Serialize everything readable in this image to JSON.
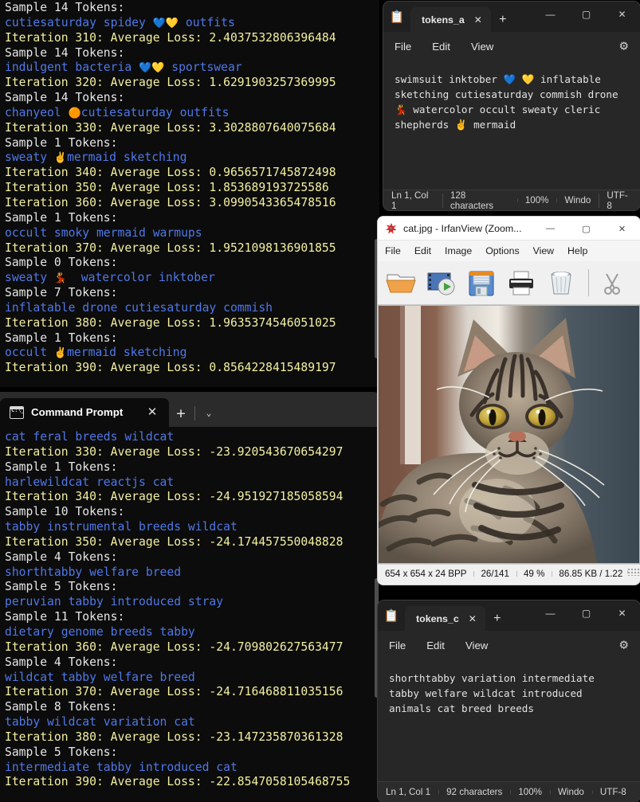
{
  "desktop": {
    "background": "#000000"
  },
  "terminal_top": {
    "background": "#0c0c0c",
    "colors": {
      "white": "#e6e6e6",
      "yellow": "#f3f0a0",
      "blue": "#4f78e8"
    },
    "lines": [
      {
        "kind": "white",
        "text": "Sample 14 Tokens:"
      },
      {
        "kind": "blue",
        "text": "cutiesaturday spidey 💙💛 outfits"
      },
      {
        "kind": "yellow",
        "text": "Iteration 310: Average Loss: 2.4037532806396484"
      },
      {
        "kind": "white",
        "text": "Sample 14 Tokens:"
      },
      {
        "kind": "blue",
        "text": "indulgent bacteria 💙💛 sportswear"
      },
      {
        "kind": "yellow",
        "text": "Iteration 320: Average Loss: 1.6291903257369995"
      },
      {
        "kind": "white",
        "text": "Sample 14 Tokens:"
      },
      {
        "kind": "blue",
        "text": "chanyeol 🟠cutiesaturday outfits"
      },
      {
        "kind": "yellow",
        "text": "Iteration 330: Average Loss: 3.3028807640075684"
      },
      {
        "kind": "white",
        "text": "Sample 1 Tokens:"
      },
      {
        "kind": "blue",
        "text": "sweaty ✌️mermaid sketching"
      },
      {
        "kind": "yellow",
        "text": "Iteration 340: Average Loss: 0.9656571745872498"
      },
      {
        "kind": "yellow",
        "text": "Iteration 350: Average Loss: 1.853689193725586"
      },
      {
        "kind": "yellow",
        "text": "Iteration 360: Average Loss: 3.0990543365478516"
      },
      {
        "kind": "white",
        "text": "Sample 1 Tokens:"
      },
      {
        "kind": "blue",
        "text": "occult smoky mermaid warmups"
      },
      {
        "kind": "yellow",
        "text": "Iteration 370: Average Loss: 1.9521098136901855"
      },
      {
        "kind": "white",
        "text": "Sample 0 Tokens:"
      },
      {
        "kind": "blue",
        "text": "sweaty 💃  watercolor inktober"
      },
      {
        "kind": "white",
        "text": "Sample 7 Tokens:"
      },
      {
        "kind": "blue",
        "text": "inflatable drone cutiesaturday commish"
      },
      {
        "kind": "yellow",
        "text": "Iteration 380: Average Loss: 1.9635374546051025"
      },
      {
        "kind": "white",
        "text": "Sample 1 Tokens:"
      },
      {
        "kind": "blue",
        "text": "occult ✌️mermaid sketching"
      },
      {
        "kind": "yellow",
        "text": "Iteration 390: Average Loss: 0.8564228415489197"
      }
    ]
  },
  "terminal_bottom": {
    "tab": {
      "icon": "cmd-icon",
      "title": "Command Prompt",
      "close": "✕",
      "new_tab": "+",
      "dropdown": "⌄"
    },
    "lines": [
      {
        "kind": "blue",
        "text": "cat feral breeds wildcat"
      },
      {
        "kind": "yellow",
        "text": "Iteration 330: Average Loss: -23.920543670654297"
      },
      {
        "kind": "white",
        "text": "Sample 1 Tokens:"
      },
      {
        "kind": "blue",
        "text": "harlewildcat reactjs cat"
      },
      {
        "kind": "yellow",
        "text": "Iteration 340: Average Loss: -24.951927185058594"
      },
      {
        "kind": "white",
        "text": "Sample 10 Tokens:"
      },
      {
        "kind": "blue",
        "text": "tabby instrumental breeds wildcat"
      },
      {
        "kind": "yellow",
        "text": "Iteration 350: Average Loss: -24.174457550048828"
      },
      {
        "kind": "white",
        "text": "Sample 4 Tokens:"
      },
      {
        "kind": "blue",
        "text": "shorthtabby welfare breed"
      },
      {
        "kind": "white",
        "text": "Sample 5 Tokens:"
      },
      {
        "kind": "blue",
        "text": "peruvian tabby introduced stray"
      },
      {
        "kind": "white",
        "text": "Sample 11 Tokens:"
      },
      {
        "kind": "blue",
        "text": "dietary genome breeds tabby"
      },
      {
        "kind": "yellow",
        "text": "Iteration 360: Average Loss: -24.709802627563477"
      },
      {
        "kind": "white",
        "text": "Sample 4 Tokens:"
      },
      {
        "kind": "blue",
        "text": "wildcat tabby welfare breed"
      },
      {
        "kind": "yellow",
        "text": "Iteration 370: Average Loss: -24.716468811035156"
      },
      {
        "kind": "white",
        "text": "Sample 8 Tokens:"
      },
      {
        "kind": "blue",
        "text": "tabby wildcat variation cat"
      },
      {
        "kind": "yellow",
        "text": "Iteration 380: Average Loss: -23.147235870361328"
      },
      {
        "kind": "white",
        "text": "Sample 5 Tokens:"
      },
      {
        "kind": "blue",
        "text": "intermediate tabby introduced cat"
      },
      {
        "kind": "yellow",
        "text": "Iteration 390: Average Loss: -22.8547058105468755"
      }
    ]
  },
  "notepad_a": {
    "app_icon": "notepad-icon",
    "tab_title": "tokens_a",
    "tab_close": "✕",
    "new_tab": "+",
    "caption": {
      "minimize": "—",
      "maximize": "▢",
      "close": "✕"
    },
    "menu": [
      "File",
      "Edit",
      "View"
    ],
    "settings_icon": "gear-icon",
    "content": "swimsuit inktober 💙 💛 inflatable\nsketching cutiesaturday commish drone\n💃 watercolor occult sweaty cleric\nshepherds ✌️ mermaid",
    "status": [
      "Ln 1, Col 1",
      "128 characters",
      "100%",
      "Windo",
      "UTF-8"
    ]
  },
  "notepad_c": {
    "app_icon": "notepad-icon",
    "tab_title": "tokens_c",
    "tab_close": "✕",
    "new_tab": "+",
    "caption": {
      "minimize": "—",
      "maximize": "▢",
      "close": "✕"
    },
    "menu": [
      "File",
      "Edit",
      "View"
    ],
    "settings_icon": "gear-icon",
    "content": "shorthtabby variation intermediate\ntabby welfare wildcat introduced\nanimals cat breed breeds",
    "status": [
      "Ln 1, Col 1",
      "92 characters",
      "100%",
      "Windo",
      "UTF-8"
    ]
  },
  "irfanview": {
    "app_icon": "irfanview-icon",
    "title": "cat.jpg - IrfanView (Zoom...",
    "caption": {
      "minimize": "—",
      "maximize": "▢",
      "close": "✕"
    },
    "menu": [
      "File",
      "Edit",
      "Image",
      "Options",
      "View",
      "Help"
    ],
    "toolbar": [
      "open-folder-icon",
      "slideshow-icon",
      "save-icon",
      "print-icon",
      "delete-icon",
      "cut-scissors-icon"
    ],
    "image_subject": "tabby-cat-photo",
    "status": [
      "654 x 654 x 24 BPP",
      "26/141",
      "49 %",
      "86.85 KB / 1.22"
    ]
  }
}
